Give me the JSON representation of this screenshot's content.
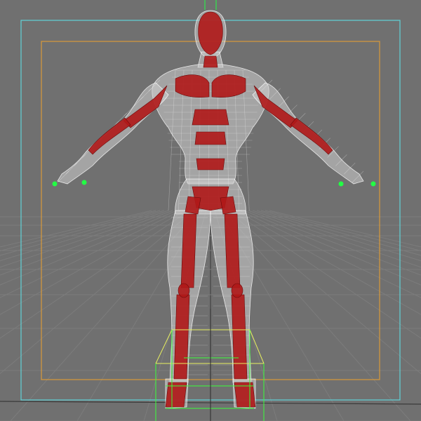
{
  "viewport": {
    "background": "#707070",
    "grid_color": "#7c7c7c",
    "axis_color": "#3a3a3a",
    "safe_action_color": "#5fd3d8",
    "safe_title_color": "#d99a3a",
    "mesh": {
      "body_fill": "#cfcfcf",
      "wire": "#ffffff",
      "muscle_fill": "#b01818",
      "muscle_dark": "#6a0a0a"
    },
    "control_colors": {
      "ik_handle": "#22ff44",
      "bounding_box": "#3aff3a",
      "bounding_box_top": "#e8f060"
    }
  }
}
